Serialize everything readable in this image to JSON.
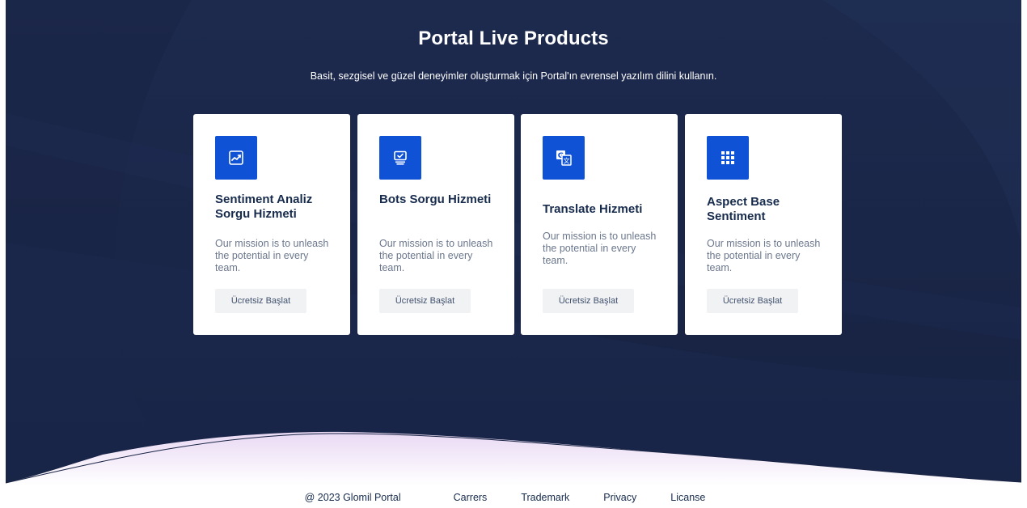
{
  "hero": {
    "title": "Portal Live Products",
    "subtitle": "Basit, sezgisel ve güzel deneyimler oluşturmak için Portal'ın evrensel yazılım dilini kullanın."
  },
  "colors": {
    "hero_background": "#1b2748",
    "card_background": "#ffffff",
    "icon_tile": "#0f52d6",
    "card_title": "#172b4d",
    "card_text": "#6b778c",
    "button_background": "#f1f2f4"
  },
  "products": [
    {
      "icon": "line-chart-icon",
      "title": "Sentiment Analiz Sorgu Hizmeti",
      "description": "Our mission is to unleash the potential in every team.",
      "button_label": "Ücretsiz Başlat"
    },
    {
      "icon": "monitor-check-icon",
      "title": "Bots Sorgu Hizmeti",
      "description": "Our mission is to unleash the potential in every team.",
      "button_label": "Ücretsiz Başlat"
    },
    {
      "icon": "translate-icon",
      "title": "Translate Hizmeti",
      "description": "Our mission is to unleash the potential in every team.",
      "button_label": "Ücretsiz Başlat"
    },
    {
      "icon": "grid-icon",
      "title": "Aspect Base Sentiment",
      "description": "Our mission is to unleash the potential in every team.",
      "button_label": "Ücretsiz Başlat"
    }
  ],
  "footer": {
    "copyright": "@ 2023 Glomil Portal",
    "links": [
      "Carrers",
      "Trademark",
      "Privacy",
      "Licanse"
    ]
  }
}
